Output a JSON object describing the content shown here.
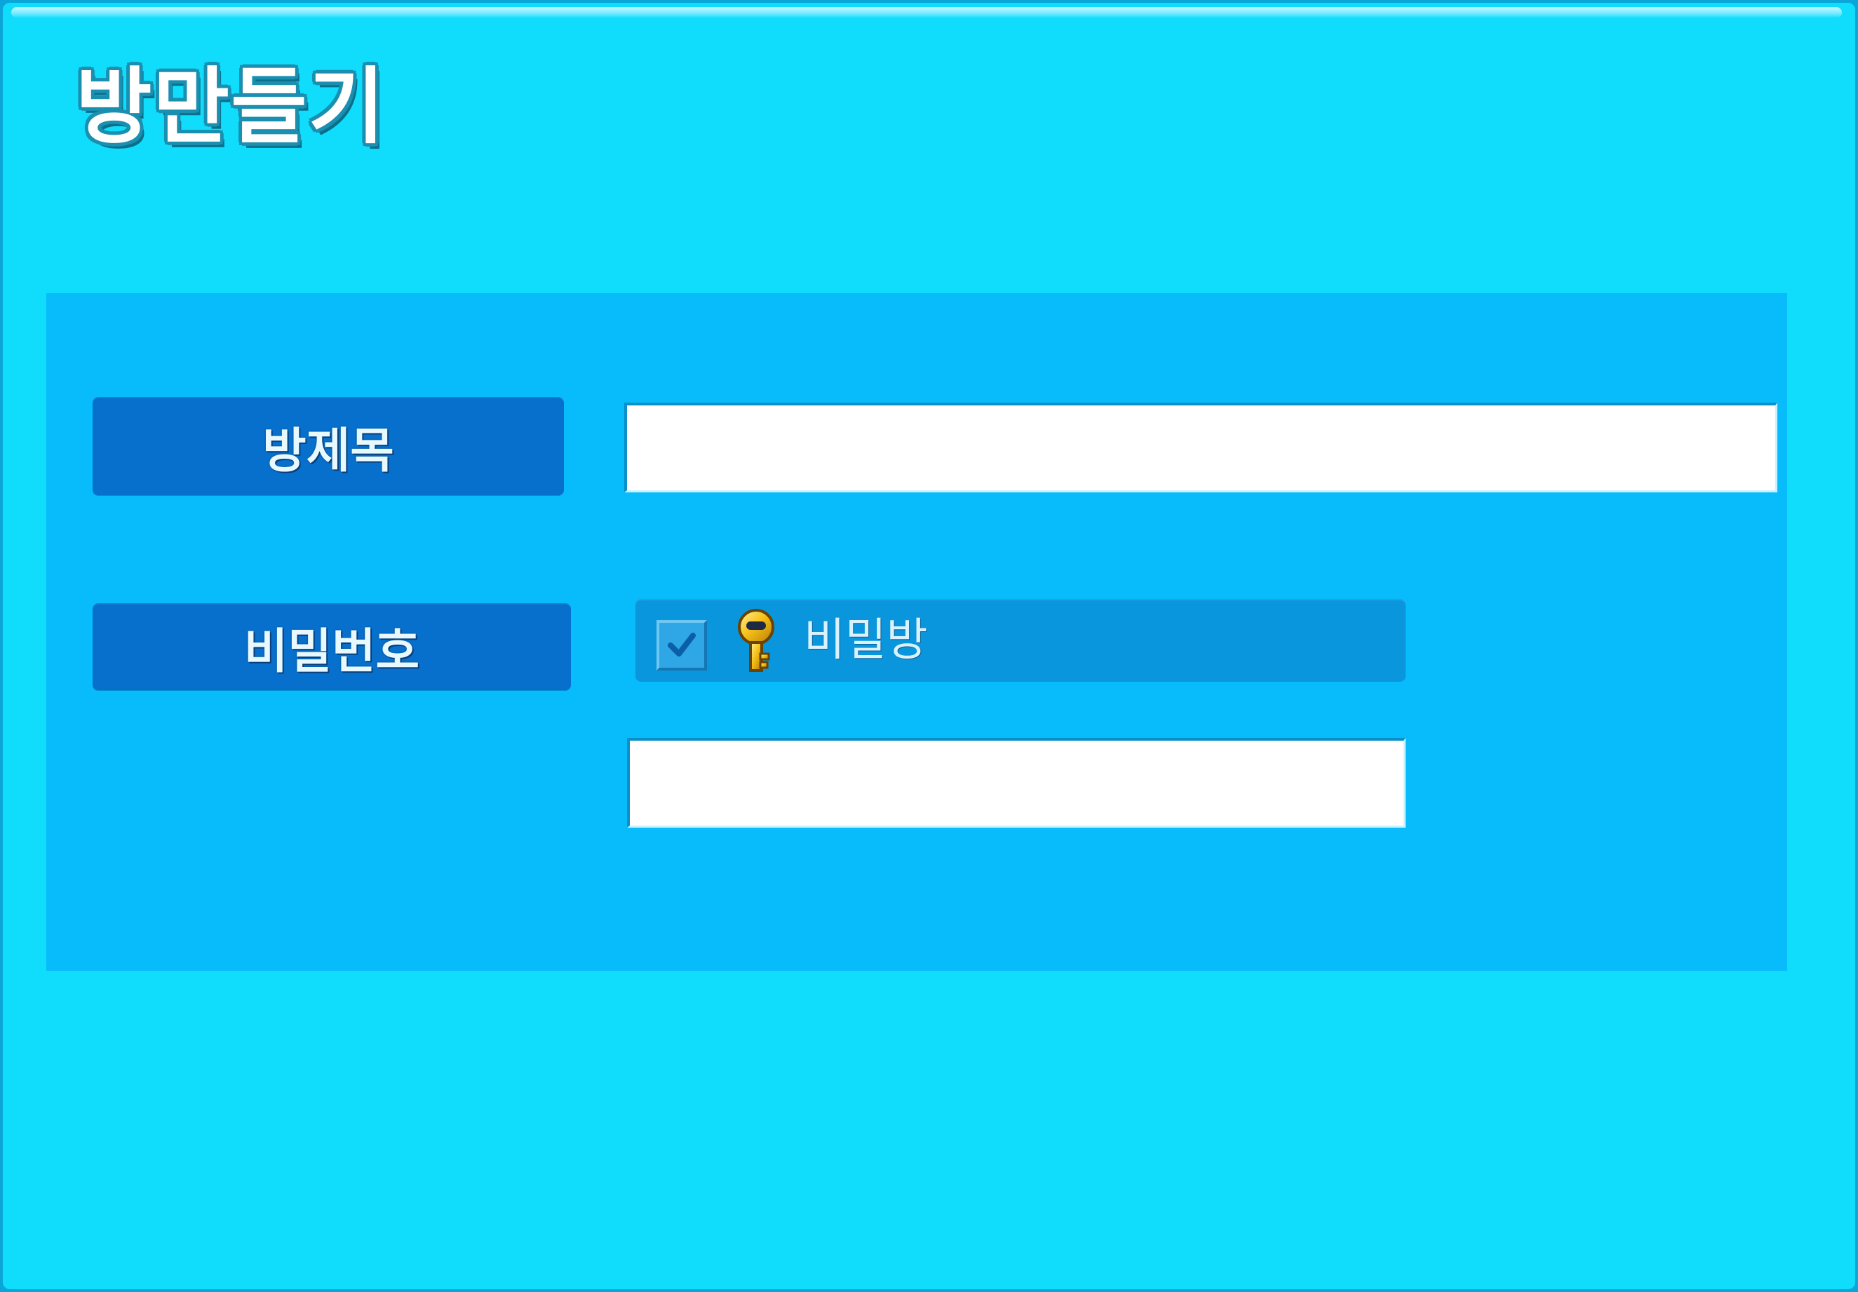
{
  "dialog": {
    "title": "방만들기"
  },
  "form": {
    "room_title": {
      "label": "방제목",
      "value": "",
      "placeholder": ""
    },
    "password": {
      "label": "비밀번호",
      "secret_room": {
        "label": "비밀방",
        "checked": true,
        "icon": "key-icon"
      },
      "value": "",
      "placeholder": ""
    }
  },
  "colors": {
    "window_bg": "#10dcfc",
    "panel_bg": "#08bcfc",
    "label_bg": "#0670cc",
    "checkbox_row_bg": "#0a96dc",
    "key": "#f2b400"
  }
}
